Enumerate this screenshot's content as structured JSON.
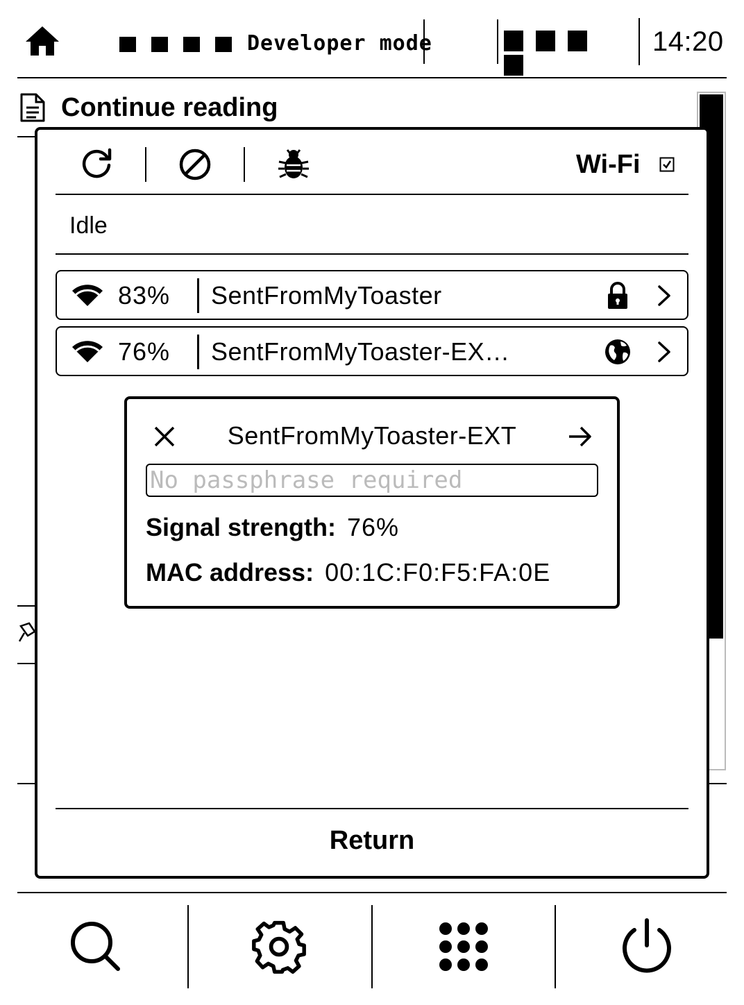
{
  "topbar": {
    "icons": [
      "home-icon"
    ],
    "dev_text": "Developer mode",
    "clock": "14:20"
  },
  "page": {
    "section_title": "Continue reading",
    "section_icon": "document-icon"
  },
  "wifi_dialog": {
    "toolbar_icons": [
      "refresh-icon",
      "disconnect-icon",
      "bug-icon"
    ],
    "title": "Wi-Fi",
    "enabled": true,
    "status": "Idle",
    "networks": [
      {
        "signal": "83%",
        "name": "SentFromMyToaster",
        "security_icon": "lock-icon"
      },
      {
        "signal": "76%",
        "name": "SentFromMyToaster-EX…",
        "security_icon": "globe-icon"
      }
    ],
    "detail": {
      "ssid": "SentFromMyToaster-EXT",
      "passphrase_placeholder": "No passphrase required",
      "signal_label": "Signal strength:",
      "signal_value": "76%",
      "mac_label": "MAC address:",
      "mac_value": "00:1C:F0:F5:FA:0E"
    },
    "return_label": "Return"
  },
  "bottom_bar": {
    "icons": [
      "search-icon",
      "settings-icon",
      "apps-icon",
      "power-icon"
    ]
  }
}
